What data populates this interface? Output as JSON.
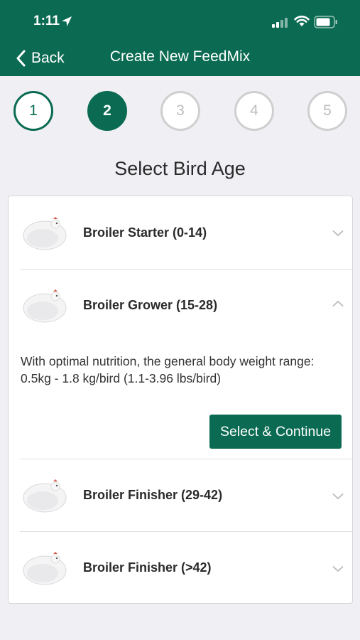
{
  "status_bar": {
    "time": "1:11"
  },
  "nav": {
    "back_label": "Back",
    "title": "Create New FeedMix"
  },
  "steps": [
    {
      "label": "1",
      "state": "done"
    },
    {
      "label": "2",
      "state": "active"
    },
    {
      "label": "3",
      "state": "todo"
    },
    {
      "label": "4",
      "state": "todo"
    },
    {
      "label": "5",
      "state": "todo"
    }
  ],
  "page": {
    "title": "Select Bird Age"
  },
  "ages": [
    {
      "title": "Broiler Starter (0-14)",
      "expanded": false
    },
    {
      "title": "Broiler Grower (15-28)",
      "expanded": true,
      "description": "With optimal nutrition, the general body weight range: 0.5kg - 1.8 kg/bird (1.1-3.96 lbs/bird)",
      "button_label": "Select & Continue"
    },
    {
      "title": "Broiler Finisher (29-42)",
      "expanded": false
    },
    {
      "title": "Broiler Finisher (>42)",
      "expanded": false
    }
  ],
  "colors": {
    "brand": "#0b6b52",
    "inactive": "#cfcfcf",
    "background": "#efeff4"
  }
}
